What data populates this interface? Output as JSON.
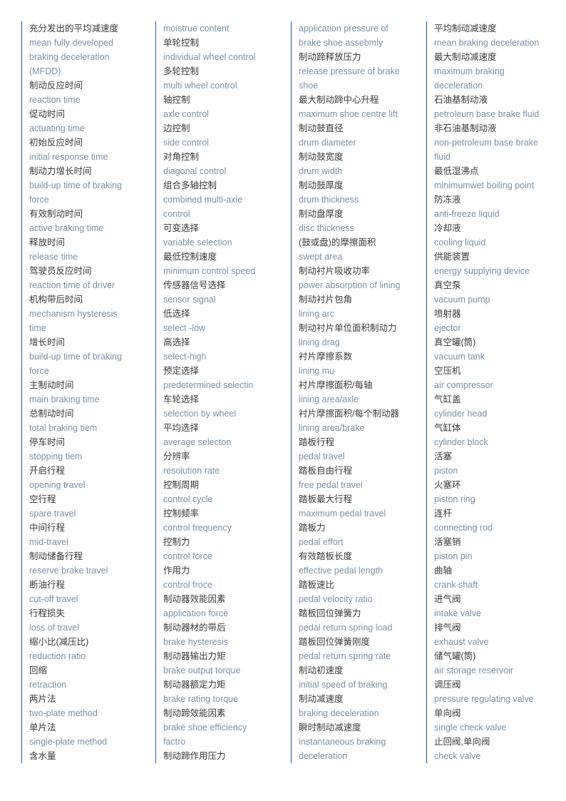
{
  "document": {
    "title": "Automotive Braking Terminology Glossary",
    "layout": "four-column bilingual term list",
    "colors": {
      "chinese_term": "#3a3a3a",
      "english_term": "#7d90a3",
      "column_rule": "#1f5c8b",
      "background": "#ffffff"
    }
  },
  "columns": [
    {
      "id": "column-1",
      "lines": [
        {
          "type": "zh",
          "text": "充分发出的平均减速度"
        },
        {
          "type": "en",
          "text": "mean fully developed"
        },
        {
          "type": "en",
          "text": "braking deceleration"
        },
        {
          "type": "en",
          "text": "(MFDD)"
        },
        {
          "type": "zh",
          "text": "制动反应时间"
        },
        {
          "type": "en",
          "text": "reaction time"
        },
        {
          "type": "zh",
          "text": "促动时间"
        },
        {
          "type": "en",
          "text": "actuating time"
        },
        {
          "type": "zh",
          "text": "初始反应时间"
        },
        {
          "type": "en",
          "text": "initial response time"
        },
        {
          "type": "zh",
          "text": "制动力增长时间"
        },
        {
          "type": "en",
          "text": "build-up time of braking"
        },
        {
          "type": "en",
          "text": "force"
        },
        {
          "type": "zh",
          "text": "有效制动时间"
        },
        {
          "type": "en",
          "text": "active braking time"
        },
        {
          "type": "zh",
          "text": "释放时间"
        },
        {
          "type": "en",
          "text": "release time"
        },
        {
          "type": "zh",
          "text": "驾驶员反应时间"
        },
        {
          "type": "en",
          "text": "reaction time of driver"
        },
        {
          "type": "zh",
          "text": "机构带后时间"
        },
        {
          "type": "en",
          "text": "mechanism hysteresis"
        },
        {
          "type": "en",
          "text": "time"
        },
        {
          "type": "zh",
          "text": "增长时间"
        },
        {
          "type": "en",
          "text": "build-up time of braking"
        },
        {
          "type": "en",
          "text": "force"
        },
        {
          "type": "zh",
          "text": "主制动时间"
        },
        {
          "type": "en",
          "text": "main braking time"
        },
        {
          "type": "zh",
          "text": "总制动时间"
        },
        {
          "type": "en",
          "text": "total braking tiem"
        },
        {
          "type": "zh",
          "text": "停车时间"
        },
        {
          "type": "en",
          "text": "stopping tiem"
        },
        {
          "type": "zh",
          "text": "开启行程"
        },
        {
          "type": "en",
          "text": "opening travel"
        },
        {
          "type": "zh",
          "text": "空行程"
        },
        {
          "type": "en",
          "text": "spare travel"
        },
        {
          "type": "zh",
          "text": "中间行程"
        },
        {
          "type": "en",
          "text": "mid-travel"
        },
        {
          "type": "zh",
          "text": "制动储备行程"
        },
        {
          "type": "en",
          "text": "reserve brake travel"
        },
        {
          "type": "zh",
          "text": "断油行程"
        },
        {
          "type": "en",
          "text": "cut-off travel"
        },
        {
          "type": "zh",
          "text": "行程损失"
        },
        {
          "type": "en",
          "text": "loss of travel"
        },
        {
          "type": "zh",
          "text": "缩小比(减压比)"
        },
        {
          "type": "en",
          "text": "reduction ratio"
        },
        {
          "type": "zh",
          "text": "回缩"
        },
        {
          "type": "en",
          "text": "retraction"
        },
        {
          "type": "zh",
          "text": "两片法"
        },
        {
          "type": "en",
          "text": "two-plate method"
        },
        {
          "type": "zh",
          "text": "单片法"
        },
        {
          "type": "en",
          "text": "single-plate method"
        },
        {
          "type": "zh",
          "text": "含水量"
        }
      ]
    },
    {
      "id": "column-2",
      "lines": [
        {
          "type": "en",
          "text": "moistrue content"
        },
        {
          "type": "zh",
          "text": "单轮控制"
        },
        {
          "type": "en",
          "text": "individual wheel control"
        },
        {
          "type": "zh",
          "text": "多轮控制"
        },
        {
          "type": "en",
          "text": "multi wheel control"
        },
        {
          "type": "zh",
          "text": "轴控制"
        },
        {
          "type": "en",
          "text": "axle control"
        },
        {
          "type": "zh",
          "text": "边控制"
        },
        {
          "type": "en",
          "text": "side control"
        },
        {
          "type": "zh",
          "text": "对角控制"
        },
        {
          "type": "en",
          "text": "diagonal control"
        },
        {
          "type": "zh",
          "text": "组合多轴控制"
        },
        {
          "type": "en",
          "text": "combined multi-axle"
        },
        {
          "type": "en",
          "text": "control"
        },
        {
          "type": "zh",
          "text": "可变选择"
        },
        {
          "type": "en",
          "text": "variable selection"
        },
        {
          "type": "zh",
          "text": "最低控制速度"
        },
        {
          "type": "en",
          "text": "minimum control speed"
        },
        {
          "type": "zh",
          "text": "传感器信号选择"
        },
        {
          "type": "en",
          "text": "sensor signal"
        },
        {
          "type": "zh",
          "text": "低选择"
        },
        {
          "type": "en",
          "text": "select -low"
        },
        {
          "type": "zh",
          "text": "高选择"
        },
        {
          "type": "en",
          "text": "select-high"
        },
        {
          "type": "zh",
          "text": "预定选择"
        },
        {
          "type": "en",
          "text": "predetermined selectin"
        },
        {
          "type": "zh",
          "text": "车轮选择"
        },
        {
          "type": "en",
          "text": "selection by wheel"
        },
        {
          "type": "zh",
          "text": "平均选择"
        },
        {
          "type": "en",
          "text": "average selecton"
        },
        {
          "type": "zh",
          "text": "分辨率"
        },
        {
          "type": "en",
          "text": "resolution rate"
        },
        {
          "type": "zh",
          "text": "控制周期"
        },
        {
          "type": "en",
          "text": "control cycle"
        },
        {
          "type": "zh",
          "text": "控制频率"
        },
        {
          "type": "en",
          "text": "control frequency"
        },
        {
          "type": "zh",
          "text": "控制力"
        },
        {
          "type": "en",
          "text": "control force"
        },
        {
          "type": "zh",
          "text": "作用力"
        },
        {
          "type": "en",
          "text": "control froce"
        },
        {
          "type": "zh",
          "text": "制动器效能因素"
        },
        {
          "type": "en",
          "text": "application force"
        },
        {
          "type": "zh",
          "text": "制动器材的带后"
        },
        {
          "type": "en",
          "text": "brake hysteresis"
        },
        {
          "type": "zh",
          "text": "制动器输出力矩"
        },
        {
          "type": "en",
          "text": "brake output torque"
        },
        {
          "type": "zh",
          "text": "制动器额定力矩"
        },
        {
          "type": "en",
          "text": "brake rating torque"
        },
        {
          "type": "zh",
          "text": "制动蹄效能因素"
        },
        {
          "type": "en",
          "text": "brake shoe efficiency"
        },
        {
          "type": "en",
          "text": "factro"
        },
        {
          "type": "zh",
          "text": "制动蹄作用压力"
        }
      ]
    },
    {
      "id": "column-3",
      "lines": [
        {
          "type": "en",
          "text": "application pressure of"
        },
        {
          "type": "en",
          "text": "brake shoe assebmly"
        },
        {
          "type": "zh",
          "text": "制动蹄释放压力"
        },
        {
          "type": "en",
          "text": "release pressure of brake"
        },
        {
          "type": "en",
          "text": "shoe"
        },
        {
          "type": "zh",
          "text": "最大制动蹄中心升程"
        },
        {
          "type": "en",
          "text": "maximum shoe centre lift"
        },
        {
          "type": "zh",
          "text": "制动鼓直径"
        },
        {
          "type": "en",
          "text": "drum diameter"
        },
        {
          "type": "zh",
          "text": "制动鼓宽度"
        },
        {
          "type": "en",
          "text": "drum width"
        },
        {
          "type": "zh",
          "text": "制动鼓厚度"
        },
        {
          "type": "en",
          "text": "drum thickness"
        },
        {
          "type": "zh",
          "text": "制动盘厚度"
        },
        {
          "type": "en",
          "text": "disc thickness"
        },
        {
          "type": "zh",
          "text": "(鼓或盘)的摩擦面积"
        },
        {
          "type": "en",
          "text": "swept area"
        },
        {
          "type": "zh",
          "text": "制动衬片吸收功率"
        },
        {
          "type": "en",
          "text": "power absorption of lining"
        },
        {
          "type": "zh",
          "text": "制动衬片包角"
        },
        {
          "type": "en",
          "text": "lining arc"
        },
        {
          "type": "zh",
          "text": "制动衬片单位面积制动力"
        },
        {
          "type": "en",
          "text": "lining drag"
        },
        {
          "type": "zh",
          "text": "衬片摩擦系数"
        },
        {
          "type": "en",
          "text": "lining mu"
        },
        {
          "type": "zh",
          "text": "衬片摩擦面积/每轴"
        },
        {
          "type": "en",
          "text": "lining area/axle"
        },
        {
          "type": "zh",
          "text": "衬片摩擦面积/每个制动器"
        },
        {
          "type": "en",
          "text": "lining area/brake"
        },
        {
          "type": "zh",
          "text": "踏板行程"
        },
        {
          "type": "en",
          "text": "pedal travel"
        },
        {
          "type": "zh",
          "text": "踏板自由行程"
        },
        {
          "type": "en",
          "text": "free pedal travel"
        },
        {
          "type": "zh",
          "text": "踏板最大行程"
        },
        {
          "type": "en",
          "text": "maximum pedal travel"
        },
        {
          "type": "zh",
          "text": "踏板力"
        },
        {
          "type": "en",
          "text": "pedal effort"
        },
        {
          "type": "zh",
          "text": "有效踏板长度"
        },
        {
          "type": "en",
          "text": "effective pedal length"
        },
        {
          "type": "zh",
          "text": "踏板速比"
        },
        {
          "type": "en",
          "text": "pedal velocity ratio"
        },
        {
          "type": "zh",
          "text": "踏板回位弹簧力"
        },
        {
          "type": "en",
          "text": "pedal return spring load"
        },
        {
          "type": "zh",
          "text": "踏板回位弹簧刚度"
        },
        {
          "type": "en",
          "text": "pedal return spring rate"
        },
        {
          "type": "zh",
          "text": "制动初速度"
        },
        {
          "type": "en",
          "text": "initial speed of braking"
        },
        {
          "type": "zh",
          "text": "制动减速度"
        },
        {
          "type": "en",
          "text": "braking deceleration"
        },
        {
          "type": "zh",
          "text": "瞬时制动减速度"
        },
        {
          "type": "en",
          "text": "instantaneous braking"
        },
        {
          "type": "en",
          "text": "deceleration"
        }
      ]
    },
    {
      "id": "column-4",
      "lines": [
        {
          "type": "zh",
          "text": "平均制动减速度"
        },
        {
          "type": "en",
          "text": "mean braking deceleration"
        },
        {
          "type": "zh",
          "text": "最大制动减速度"
        },
        {
          "type": "en",
          "text": "maximum braking"
        },
        {
          "type": "en",
          "text": "deceleration"
        },
        {
          "type": "zh",
          "text": "石油基制动液"
        },
        {
          "type": "en",
          "text": "petroleum base brake fluid"
        },
        {
          "type": "zh",
          "text": "非石油基制动液"
        },
        {
          "type": "en",
          "text": "non-petroleum base brake"
        },
        {
          "type": "en",
          "text": "fluid"
        },
        {
          "type": "zh",
          "text": "最低湿沸点"
        },
        {
          "type": "en",
          "text": "minimumwet boiling point"
        },
        {
          "type": "zh",
          "text": "防冻液"
        },
        {
          "type": "en",
          "text": "anti-freeze liquid"
        },
        {
          "type": "zh",
          "text": "冷却液"
        },
        {
          "type": "en",
          "text": "cooling liquid"
        },
        {
          "type": "zh",
          "text": "供能装置"
        },
        {
          "type": "en",
          "text": "energy supplying device"
        },
        {
          "type": "zh",
          "text": "真空泵"
        },
        {
          "type": "en",
          "text": "vacuum pump"
        },
        {
          "type": "zh",
          "text": "喷射器"
        },
        {
          "type": "en",
          "text": "ejector"
        },
        {
          "type": "zh",
          "text": "真空罐(筒)"
        },
        {
          "type": "en",
          "text": "vacuum tank"
        },
        {
          "type": "zh",
          "text": "空压机"
        },
        {
          "type": "en",
          "text": "air compressor"
        },
        {
          "type": "zh",
          "text": "气缸盖"
        },
        {
          "type": "en",
          "text": "cylinder head"
        },
        {
          "type": "zh",
          "text": "气缸体"
        },
        {
          "type": "en",
          "text": "cylinder block"
        },
        {
          "type": "zh",
          "text": "活塞"
        },
        {
          "type": "en",
          "text": "piston"
        },
        {
          "type": "zh",
          "text": "火塞环"
        },
        {
          "type": "en",
          "text": "piston ring"
        },
        {
          "type": "zh",
          "text": "连杆"
        },
        {
          "type": "en",
          "text": "connecting rod"
        },
        {
          "type": "zh",
          "text": "活塞销"
        },
        {
          "type": "en",
          "text": "piston pin"
        },
        {
          "type": "zh",
          "text": "曲轴"
        },
        {
          "type": "en",
          "text": "crank shaft"
        },
        {
          "type": "zh",
          "text": "进气阀"
        },
        {
          "type": "en",
          "text": "intake valve"
        },
        {
          "type": "zh",
          "text": "排气阀"
        },
        {
          "type": "en",
          "text": "exhaust valve"
        },
        {
          "type": "zh",
          "text": "储气罐(筒)"
        },
        {
          "type": "en",
          "text": "air storage reservoir"
        },
        {
          "type": "zh",
          "text": "调压阀"
        },
        {
          "type": "en",
          "text": "pressure regulating valve"
        },
        {
          "type": "zh",
          "text": "单向阀"
        },
        {
          "type": "en",
          "text": "single check valve"
        },
        {
          "type": "zh",
          "text": "止回阀,单向阀"
        },
        {
          "type": "en",
          "text": "check valve"
        }
      ]
    }
  ]
}
